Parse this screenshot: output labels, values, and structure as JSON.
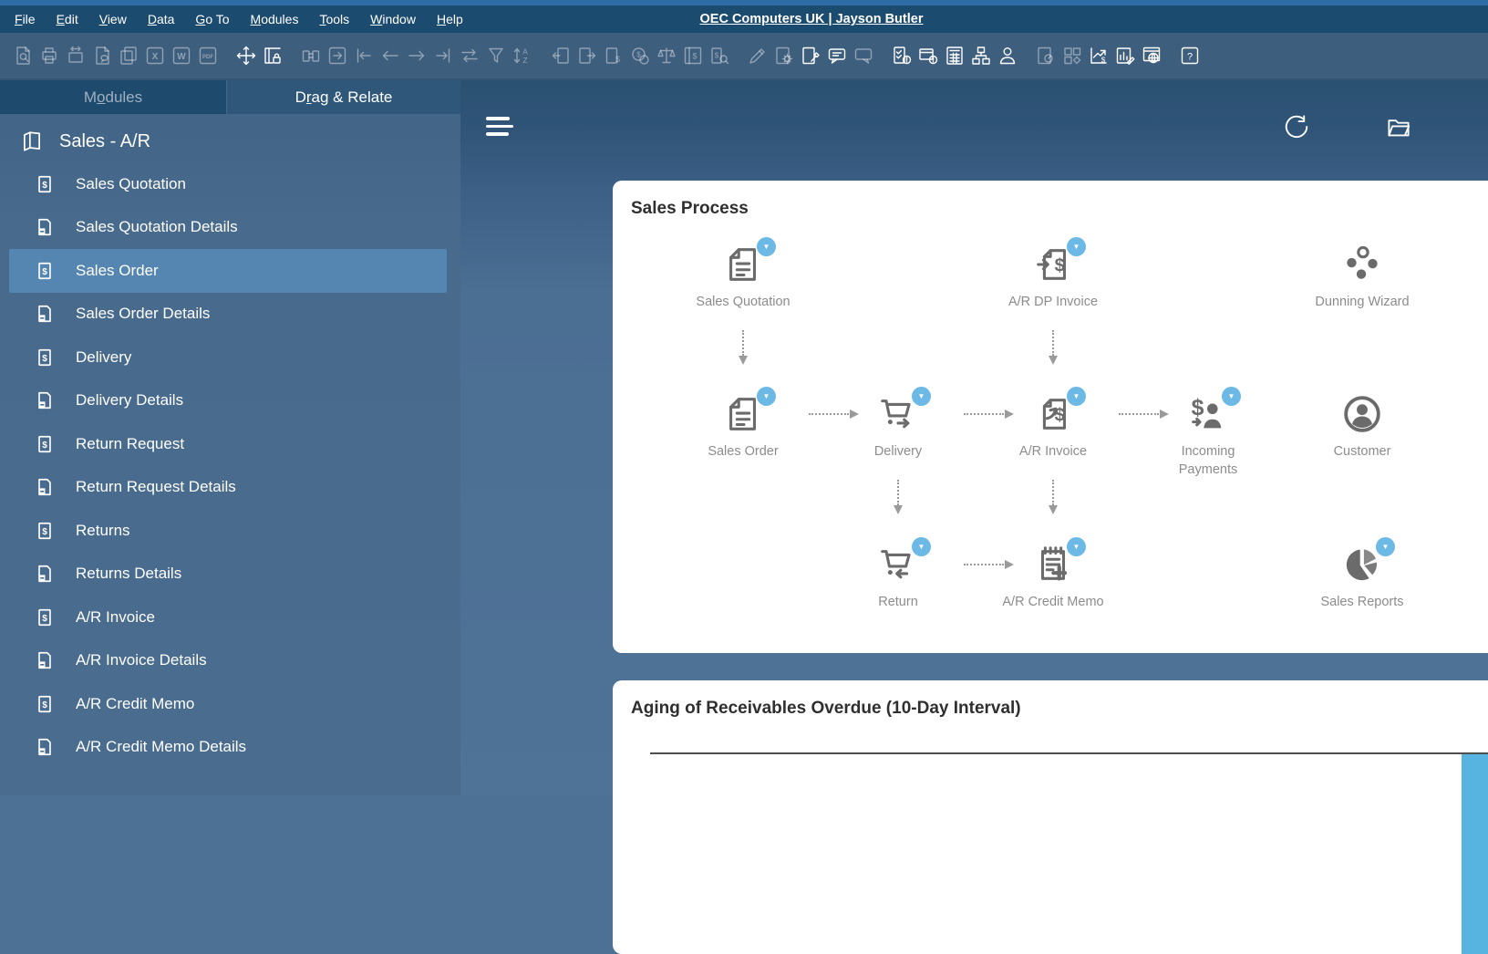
{
  "window": {
    "title": "OEC Computers UK | Jayson Butler"
  },
  "menu": {
    "items": [
      "File",
      "Edit",
      "View",
      "Data",
      "Go To",
      "Modules",
      "Tools",
      "Window",
      "Help"
    ]
  },
  "toolbar": {
    "icons": [
      {
        "name": "find-document-icon",
        "type": "doc-search",
        "active": false
      },
      {
        "name": "print-icon",
        "type": "printer",
        "active": false
      },
      {
        "name": "print-preview-icon",
        "type": "printer-preview",
        "active": false
      },
      {
        "name": "document-printing-icon",
        "type": "doc-chat",
        "active": false
      },
      {
        "name": "copy-icon",
        "type": "copy",
        "active": false
      },
      {
        "name": "export-excel-icon",
        "type": "letter",
        "overlay": "X",
        "active": false
      },
      {
        "name": "export-word-icon",
        "type": "letter",
        "overlay": "W",
        "active": false
      },
      {
        "name": "export-pdf-icon",
        "type": "letter",
        "overlay": "PDF",
        "active": false
      },
      {
        "name": "move-icon",
        "type": "move",
        "active": true,
        "gapBefore": true
      },
      {
        "name": "lock-screen-icon",
        "type": "table-lock",
        "active": true
      },
      {
        "name": "find-icon",
        "type": "binoculars",
        "active": false,
        "gapBefore": true
      },
      {
        "name": "open-window-icon",
        "type": "box-arrow",
        "active": false
      },
      {
        "name": "first-record-icon",
        "type": "arrow-first",
        "active": false
      },
      {
        "name": "previous-record-icon",
        "type": "arrow-prev",
        "active": false
      },
      {
        "name": "next-record-icon",
        "type": "arrow-next",
        "active": false
      },
      {
        "name": "last-record-icon",
        "type": "arrow-last",
        "active": false
      },
      {
        "name": "refresh-record-icon",
        "type": "swap",
        "active": false
      },
      {
        "name": "filter-icon",
        "type": "funnel",
        "active": false
      },
      {
        "name": "sort-icon",
        "type": "sort-az",
        "active": false
      },
      {
        "name": "base-document-icon",
        "type": "doc-arrow-left",
        "active": false,
        "gapBefore": true
      },
      {
        "name": "target-document-icon",
        "type": "doc-arrow-right",
        "active": false
      },
      {
        "name": "payment-means-icon",
        "type": "doc-dollar",
        "active": false
      },
      {
        "name": "payment-wizard-icon",
        "type": "coin",
        "active": false
      },
      {
        "name": "gross-profit-icon",
        "type": "scales",
        "active": false
      },
      {
        "name": "volume-weight-icon",
        "type": "dollar-box",
        "active": false
      },
      {
        "name": "transaction-journal-icon",
        "type": "dollar-search",
        "active": false
      },
      {
        "name": "edit-icon",
        "type": "pencil",
        "active": false,
        "gapBefore": true
      },
      {
        "name": "form-settings-icon",
        "type": "doc-gear",
        "active": false
      },
      {
        "name": "document-settings-icon",
        "type": "doc-wrench",
        "active": true
      },
      {
        "name": "messages-icon",
        "type": "chat",
        "active": true
      },
      {
        "name": "reply-icon",
        "type": "chat-reply",
        "active": false
      },
      {
        "name": "alerts-icon",
        "type": "doc-alert",
        "active": true,
        "gapBefore": true
      },
      {
        "name": "approval-status-icon",
        "type": "card-alert",
        "active": true
      },
      {
        "name": "calculator-icon",
        "type": "calculator",
        "active": true
      },
      {
        "name": "organization-chart-icon",
        "type": "org-chart",
        "active": true
      },
      {
        "name": "my-profile-icon",
        "type": "person",
        "active": true
      },
      {
        "name": "dashboard-icon",
        "type": "doc-gauge",
        "active": false,
        "gapBefore": true
      },
      {
        "name": "widgets-icon",
        "type": "grid",
        "active": false
      },
      {
        "name": "exchange-rate-icon",
        "type": "chart-dollar",
        "active": true
      },
      {
        "name": "report-designer-icon",
        "type": "chart-pencil",
        "active": true
      },
      {
        "name": "web-client-icon",
        "type": "browser-globe",
        "active": true
      },
      {
        "name": "help-icon",
        "type": "help",
        "active": true,
        "gapBefore": true
      }
    ]
  },
  "sidebar": {
    "tabs": [
      {
        "label": "Modules",
        "pre": "M",
        "mn": "o",
        "post": "dules",
        "active": false
      },
      {
        "label": "Drag & Relate",
        "pre": "D",
        "mn": "r",
        "post": "ag & Relate",
        "active": true
      }
    ],
    "section_title": "Sales - A/R",
    "items": [
      {
        "label": "Sales Quotation",
        "icon": "dollar-doc"
      },
      {
        "label": "Sales Quotation Details",
        "icon": "details-doc"
      },
      {
        "label": "Sales Order",
        "icon": "dollar-doc",
        "selected": true
      },
      {
        "label": "Sales Order Details",
        "icon": "details-doc"
      },
      {
        "label": "Delivery",
        "icon": "dollar-doc"
      },
      {
        "label": "Delivery Details",
        "icon": "details-doc"
      },
      {
        "label": "Return Request",
        "icon": "dollar-doc"
      },
      {
        "label": "Return Request Details",
        "icon": "details-doc"
      },
      {
        "label": "Returns",
        "icon": "dollar-doc"
      },
      {
        "label": "Returns Details",
        "icon": "details-doc"
      },
      {
        "label": "A/R Invoice",
        "icon": "dollar-doc"
      },
      {
        "label": "A/R Invoice Details",
        "icon": "details-doc"
      },
      {
        "label": "A/R Credit Memo",
        "icon": "dollar-doc"
      },
      {
        "label": "A/R Credit Memo Details",
        "icon": "details-doc"
      }
    ]
  },
  "content": {
    "header_icons": [
      "menu-icon",
      "refresh-icon",
      "open-folder-icon"
    ],
    "cards": [
      {
        "title": "Sales Process",
        "nodes": [
          {
            "label": "Sales Quotation",
            "icon": "document",
            "badge": true,
            "col": 1,
            "row": 1
          },
          {
            "label": "A/R DP Invoice",
            "icon": "doc-dollar-in",
            "badge": true,
            "col": 3,
            "row": 1
          },
          {
            "label": "Dunning Wizard",
            "icon": "dunning",
            "badge": false,
            "col": 5,
            "row": 1
          },
          {
            "label": "Sales Order",
            "icon": "document",
            "badge": true,
            "col": 1,
            "row": 2
          },
          {
            "label": "Delivery",
            "icon": "cart",
            "badge": true,
            "col": 2,
            "row": 2
          },
          {
            "label": "A/R Invoice",
            "icon": "doc-dollar-up",
            "badge": true,
            "col": 3,
            "row": 2
          },
          {
            "label": "Incoming Payments",
            "icon": "money-person",
            "badge": true,
            "col": 4,
            "row": 2
          },
          {
            "label": "Customer",
            "icon": "person-circle",
            "badge": false,
            "col": 5,
            "row": 2
          },
          {
            "label": "Return",
            "icon": "cart-return",
            "badge": true,
            "col": 2,
            "row": 3
          },
          {
            "label": "A/R Credit Memo",
            "icon": "clipboard-plus",
            "badge": true,
            "col": 3,
            "row": 3
          },
          {
            "label": "Sales Reports",
            "icon": "pie",
            "badge": true,
            "col": 5,
            "row": 3
          }
        ],
        "arrows": [
          {
            "type": "v",
            "col": 1,
            "rows": [
              1,
              2
            ]
          },
          {
            "type": "v",
            "col": 3,
            "rows": [
              1,
              2
            ]
          },
          {
            "type": "h",
            "row": 2,
            "cols": [
              1,
              2
            ]
          },
          {
            "type": "h",
            "row": 2,
            "cols": [
              2,
              3
            ]
          },
          {
            "type": "h",
            "row": 2,
            "cols": [
              3,
              4
            ]
          },
          {
            "type": "v",
            "col": 2,
            "rows": [
              2,
              3
            ]
          },
          {
            "type": "v",
            "col": 3,
            "rows": [
              2,
              3
            ]
          },
          {
            "type": "h",
            "row": 3,
            "cols": [
              2,
              3
            ]
          }
        ]
      },
      {
        "title": "Aging of Receivables Overdue (10-Day Interval)"
      }
    ]
  },
  "colors": {
    "badge_blue": "#6cb9e6",
    "chart_bar_blue": "#57b4e1",
    "selected_item_blue": "#5585b1",
    "menu_bar_navy": "#1c4b70",
    "panel_steel_blue": "#4a6c8e"
  }
}
